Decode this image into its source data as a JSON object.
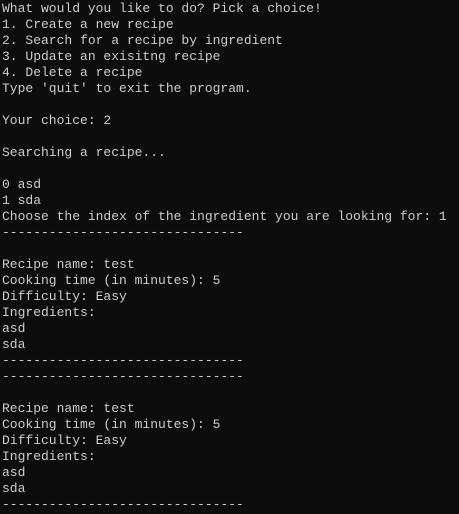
{
  "terminal": {
    "lines": [
      "What would you like to do? Pick a choice!",
      "1. Create a new recipe",
      "2. Search for a recipe by ingredient",
      "3. Update an exisitng recipe",
      "4. Delete a recipe",
      "Type 'quit' to exit the program.",
      "",
      "Your choice: 2",
      "",
      "Searching a recipe...",
      "",
      "0 asd",
      "1 sda",
      "Choose the index of the ingredient you are looking for: 1",
      "-------------------------------",
      "",
      "Recipe name: test",
      "Cooking time (in minutes): 5",
      "Difficulty: Easy",
      "Ingredients:",
      "asd",
      "sda",
      "-------------------------------",
      "-------------------------------",
      "",
      "Recipe name: test",
      "Cooking time (in minutes): 5",
      "Difficulty: Easy",
      "Ingredients:",
      "asd",
      "sda",
      "-------------------------------"
    ]
  }
}
